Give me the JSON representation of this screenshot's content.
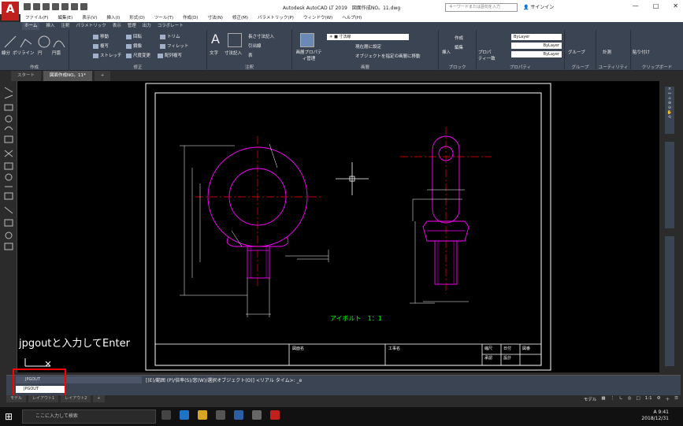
{
  "app": {
    "logo_letter": "A",
    "window_title": "Autodesk AutoCAD LT 2019　図面作成NO。11.dwg",
    "search_placeholder": "キーワードまたは語句を入力",
    "signin_label": "サインイン",
    "window_controls": [
      "—",
      "□",
      "✕"
    ]
  },
  "menu": [
    "ファイル(F)",
    "編集(E)",
    "表示(V)",
    "挿入(I)",
    "形式(O)",
    "ツール(T)",
    "作成(D)",
    "寸法(N)",
    "修正(M)",
    "パラメトリック(P)",
    "ウィンドウ(W)",
    "ヘルプ(H)"
  ],
  "ribbon_tabs": [
    "ホーム",
    "挿入",
    "注釈",
    "パラメトリック",
    "表示",
    "管理",
    "出力",
    "コラボレート"
  ],
  "ribbon": {
    "draw": {
      "title": "作成",
      "items": [
        "線分",
        "ポリライン",
        "円",
        "円弧"
      ]
    },
    "modify": {
      "title": "修正",
      "items": [
        "移動",
        "回転",
        "トリム",
        "複写",
        "鏡像",
        "フィレット",
        "ストレッチ",
        "尺度変更",
        "配列複写"
      ]
    },
    "annotation": {
      "title": "注釈",
      "items": [
        "文字",
        "寸法記入",
        "長さ寸法記入",
        "引出線",
        "表"
      ]
    },
    "layers": {
      "title": "画層",
      "items": [
        "画層プロパティ管理",
        "現在層に設定",
        "オブジェクトを指定の画層に移動"
      ]
    },
    "block": {
      "title": "ブロック",
      "items": [
        "挿入",
        "作成",
        "編集"
      ]
    },
    "properties": {
      "title": "プロパティ",
      "items": [
        "プロパティ一致",
        "ByLayer",
        "ByLayer",
        "ByLayer"
      ]
    },
    "groups": {
      "title": "グループ",
      "items": [
        "グループ"
      ]
    },
    "utilities": {
      "title": "ユーティリティ",
      "items": [
        "計測"
      ]
    },
    "clipboard": {
      "title": "クリップボード",
      "items": [
        "貼り付け"
      ]
    }
  },
  "doc_tabs": [
    "スタート",
    "図面作成NO。11*",
    "+"
  ],
  "drawing": {
    "caption": "アイボルト　1：1",
    "titleblock": [
      "図面名",
      "工事名",
      "縮尺",
      "日付",
      "図番",
      "承認",
      "設計"
    ],
    "line_color": "#ff00ff",
    "center_color": "#ff0000",
    "dim_color": "#ffffff",
    "caption_color": "#00ff00"
  },
  "annotation_text": "jpgoutと入力してEnter",
  "command": {
    "history": "[(E)/範囲 (P)/倍率(S)/窓(W)/選択オブジェクト(O)] <リアル タイム>: _e",
    "header": "JPGOUT",
    "input_value": "JPGOUT"
  },
  "layout_tabs": [
    "モデル",
    "レイアウト1",
    "レイアウト2",
    "+"
  ],
  "status": {
    "model_label": "モデル",
    "scale": "1:1"
  },
  "taskbar": {
    "search_placeholder": "ここに入力して検索",
    "time": "9:41",
    "date": "2018/12/31",
    "ime": "A"
  }
}
